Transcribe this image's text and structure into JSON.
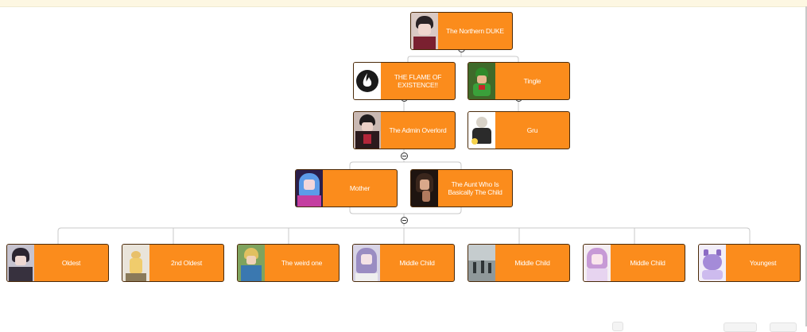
{
  "nodes": {
    "n_duke": {
      "label": "The Northern DUKE",
      "avatar_icon": "dark-haired-character-avatar-icon"
    },
    "n_flame": {
      "label": "THE FLAME OF EXISTENCE!!",
      "avatar_icon": "flame-logo-icon"
    },
    "n_tingle": {
      "label": "Tingle",
      "avatar_icon": "green-costume-character-avatar-icon"
    },
    "n_admin": {
      "label": "The Admin Overlord",
      "avatar_icon": "dark-haired-character-avatar-icon"
    },
    "n_gru": {
      "label": "Gru",
      "avatar_icon": "bald-character-avatar-icon"
    },
    "n_mother": {
      "label": "Mother",
      "avatar_icon": "blue-haired-character-avatar-icon"
    },
    "n_aunt": {
      "label": "The Aunt Who Is Basically The Child",
      "avatar_icon": "dark-portrait-avatar-icon"
    },
    "n_oldest": {
      "label": "Oldest",
      "avatar_icon": "dark-haired-character-avatar-icon"
    },
    "n_2nd": {
      "label": "2nd Oldest",
      "avatar_icon": "yellow-figure-avatar-icon"
    },
    "n_weird": {
      "label": "The weird one",
      "avatar_icon": "green-character-avatar-icon"
    },
    "n_middle1": {
      "label": "Middle Child",
      "avatar_icon": "lavender-character-avatar-icon"
    },
    "n_middle2": {
      "label": "Middle Child",
      "avatar_icon": "gray-scene-avatar-icon"
    },
    "n_middle3": {
      "label": "Middle Child",
      "avatar_icon": "pink-haired-character-avatar-icon"
    },
    "n_youngest": {
      "label": "Youngest",
      "avatar_icon": "purple-cat-character-avatar-icon"
    }
  },
  "colors": {
    "node_fill": "#fb8c1c",
    "node_border": "#4a2a0a",
    "node_text": "#ffffff",
    "connector": "#c8c8c8",
    "top_strip": "#fdf7e2"
  }
}
